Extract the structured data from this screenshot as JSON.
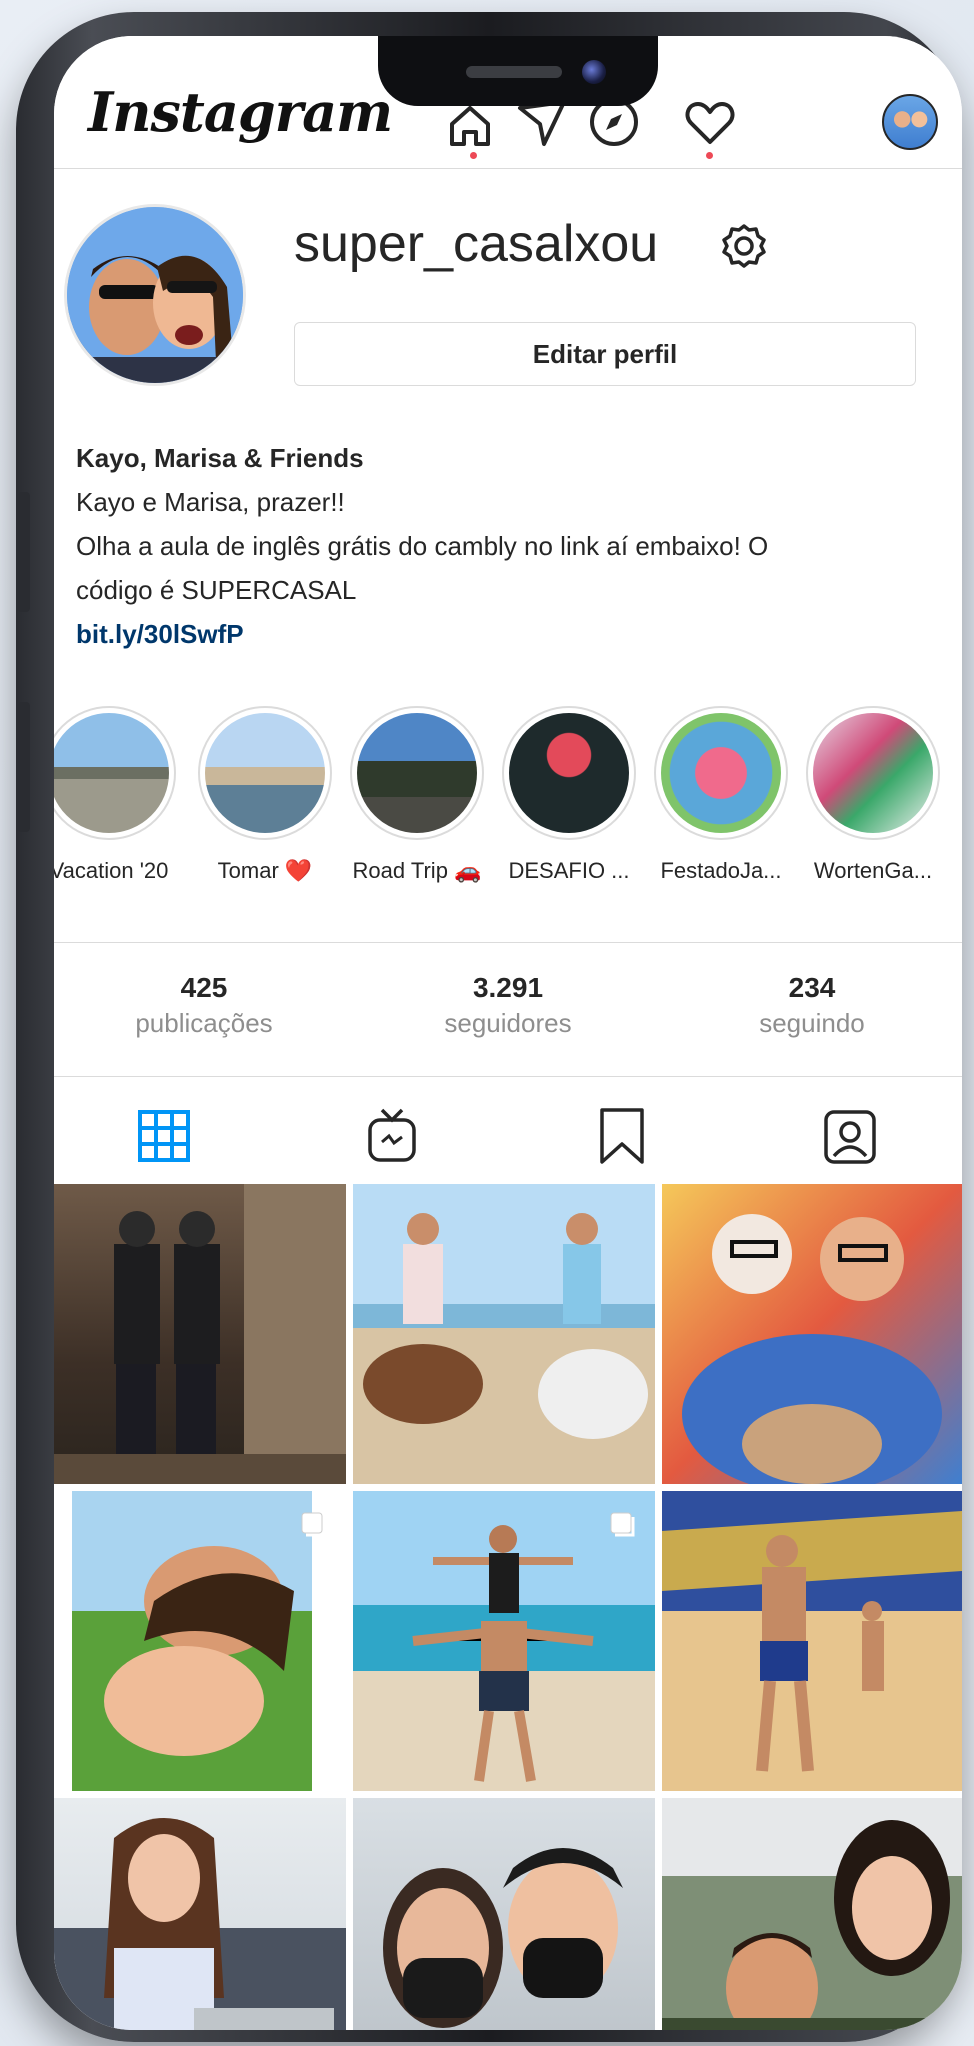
{
  "app": {
    "name": "Instagram"
  },
  "topbar": {
    "icons": [
      "home-icon",
      "direct-icon",
      "explore-icon",
      "activity-icon",
      "profile-avatar"
    ],
    "notification_color": "#ed4956"
  },
  "profile": {
    "username": "super_casalxou",
    "edit_button": "Editar perfil",
    "bio_name": "Kayo, Marisa & Friends",
    "bio_line1": "Kayo e Marisa, prazer!!",
    "bio_line2": "Olha a aula de inglês grátis do cambly no link aí embaixo! O",
    "bio_line3": "código é SUPERCASAL",
    "bio_link": "bit.ly/30lSwfP"
  },
  "highlights": [
    {
      "label": "Vacation '20"
    },
    {
      "label": "Tomar ❤️"
    },
    {
      "label": "Road Trip 🚗"
    },
    {
      "label": "DESAFIO ..."
    },
    {
      "label": "FestadoJa..."
    },
    {
      "label": "WortenGa..."
    }
  ],
  "stats": {
    "posts": {
      "value": "425",
      "label": "publicações"
    },
    "followers": {
      "value": "3.291",
      "label": "seguidores"
    },
    "following": {
      "value": "234",
      "label": "seguindo"
    }
  },
  "tabs": [
    "grid-icon",
    "igtv-icon",
    "saved-icon",
    "tagged-icon"
  ],
  "colors": {
    "accent": "#0095f6",
    "link": "#00376b",
    "muted": "#8e8e8e",
    "border": "#dbdbdb"
  },
  "grid_posts": [
    {
      "type": "photo"
    },
    {
      "type": "photo"
    },
    {
      "type": "photo"
    },
    {
      "type": "carousel"
    },
    {
      "type": "carousel"
    },
    {
      "type": "photo"
    },
    {
      "type": "photo"
    },
    {
      "type": "photo"
    },
    {
      "type": "photo"
    }
  ]
}
